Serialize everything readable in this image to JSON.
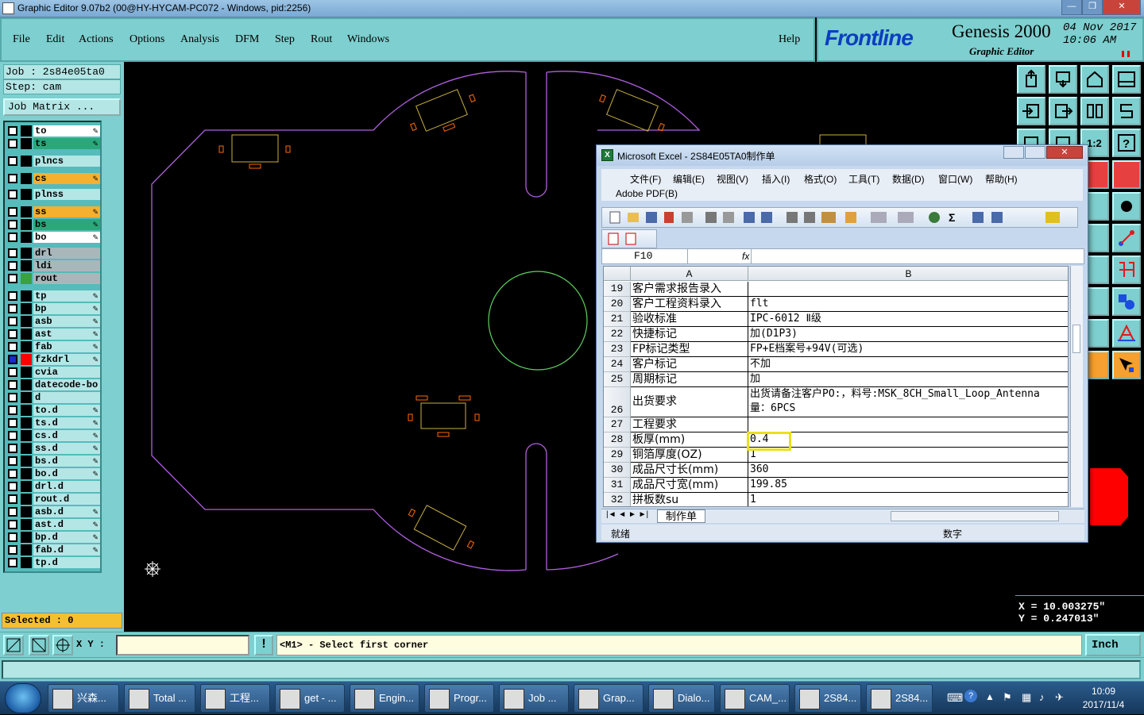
{
  "window": {
    "title": "Graphic Editor 9.07b2 (00@HY-HYCAM-PC072 - Windows, pid:2256)",
    "controls": [
      "—",
      "❐",
      "✕"
    ]
  },
  "menu": {
    "items": [
      "File",
      "Edit",
      "Actions",
      "Options",
      "Analysis",
      "DFM",
      "Step",
      "Rout",
      "Windows"
    ],
    "help": "Help"
  },
  "brand": {
    "logo": "Frontline",
    "product": "Genesis 2000",
    "subtitle": "Graphic Editor",
    "date": "04 Nov 2017",
    "time": "10:06 AM"
  },
  "left": {
    "job": "Job : 2s84e05ta0",
    "step": "Step: cam",
    "job_matrix": "Job Matrix ...",
    "selected": "Selected : 0",
    "layers": [
      {
        "name": "to",
        "color": "#ffffff",
        "swatch": "#000000",
        "editable": true
      },
      {
        "name": "ts",
        "color": "#2aa87a",
        "swatch": "#000000",
        "editable": true
      },
      {
        "name": "plncs",
        "color": "#b4e6e6",
        "swatch": "#000000",
        "editable": false
      },
      {
        "name": "cs",
        "color": "#f5b030",
        "swatch": "#000000",
        "editable": true
      },
      {
        "name": "plnss",
        "color": "#b4e6e6",
        "swatch": "#000000",
        "editable": false
      },
      {
        "name": "ss",
        "color": "#f5b030",
        "swatch": "#000000",
        "editable": true
      },
      {
        "name": "bs",
        "color": "#2aa87a",
        "swatch": "#000000",
        "editable": true
      },
      {
        "name": "bo",
        "color": "#ffffff",
        "swatch": "#000000",
        "editable": true
      },
      {
        "name": "drl",
        "color": "#a9b7bb",
        "swatch": "#000000",
        "editable": false
      },
      {
        "name": "ldi",
        "color": "#a9b7bb",
        "swatch": "#000000",
        "editable": false
      },
      {
        "name": "rout",
        "color": "#a9b7bb",
        "swatch": "#3aa040",
        "editable": false
      },
      {
        "name": "tp",
        "color": "#b4e6e6",
        "swatch": "#000000",
        "editable": true
      },
      {
        "name": "bp",
        "color": "#b4e6e6",
        "swatch": "#000000",
        "editable": true
      },
      {
        "name": "asb",
        "color": "#b4e6e6",
        "swatch": "#000000",
        "editable": true
      },
      {
        "name": "ast",
        "color": "#b4e6e6",
        "swatch": "#000000",
        "editable": true
      },
      {
        "name": "fab",
        "color": "#b4e6e6",
        "swatch": "#000000",
        "editable": true
      },
      {
        "name": "fzkdrl",
        "color": "#b4e6e6",
        "swatch": "#ff0000",
        "editable": true,
        "active": true
      },
      {
        "name": "cvia",
        "color": "#b4e6e6",
        "swatch": "#000000",
        "editable": false
      },
      {
        "name": "datecode-bo",
        "color": "#b4e6e6",
        "swatch": "#000000",
        "editable": false
      },
      {
        "name": "d",
        "color": "#b4e6e6",
        "swatch": "#000000",
        "editable": false
      },
      {
        "name": "to.d",
        "color": "#b4e6e6",
        "swatch": "#000000",
        "editable": true
      },
      {
        "name": "ts.d",
        "color": "#b4e6e6",
        "swatch": "#000000",
        "editable": true
      },
      {
        "name": "cs.d",
        "color": "#b4e6e6",
        "swatch": "#000000",
        "editable": true
      },
      {
        "name": "ss.d",
        "color": "#b4e6e6",
        "swatch": "#000000",
        "editable": true
      },
      {
        "name": "bs.d",
        "color": "#b4e6e6",
        "swatch": "#000000",
        "editable": true
      },
      {
        "name": "bo.d",
        "color": "#b4e6e6",
        "swatch": "#000000",
        "editable": true
      },
      {
        "name": "drl.d",
        "color": "#b4e6e6",
        "swatch": "#000000",
        "editable": false
      },
      {
        "name": "rout.d",
        "color": "#b4e6e6",
        "swatch": "#000000",
        "editable": false
      },
      {
        "name": "asb.d",
        "color": "#b4e6e6",
        "swatch": "#000000",
        "editable": true
      },
      {
        "name": "ast.d",
        "color": "#b4e6e6",
        "swatch": "#000000",
        "editable": true
      },
      {
        "name": "bp.d",
        "color": "#b4e6e6",
        "swatch": "#000000",
        "editable": true
      },
      {
        "name": "fab.d",
        "color": "#b4e6e6",
        "swatch": "#000000",
        "editable": true
      },
      {
        "name": "tp.d",
        "color": "#b4e6e6",
        "swatch": "#000000",
        "editable": false
      }
    ]
  },
  "coords": {
    "x": "X = 10.003275\"",
    "y": "Y = 0.247013\""
  },
  "command": {
    "xy_label": "X Y :",
    "xy_value": "",
    "prompt": "<M1> - Select first corner",
    "unit": "Inch"
  },
  "excel": {
    "title": "Microsoft Excel - 2S84E05TA0制作单",
    "menu": [
      "文件(F)",
      "编辑(E)",
      "视图(V)",
      "插入(I)",
      "格式(O)",
      "工具(T)",
      "数据(D)",
      "窗口(W)",
      "帮助(H)"
    ],
    "pdf_menu": "Adobe PDF(B)",
    "name_box": "F10",
    "fx": "fx",
    "col_a": "A",
    "col_b": "B",
    "rows": [
      {
        "n": "19",
        "a": "客户需求报告录入",
        "b": ""
      },
      {
        "n": "20",
        "a": "客户工程资料录入",
        "b": "flt"
      },
      {
        "n": "21",
        "a": "验收标准",
        "b": "IPC-6012 Ⅱ级"
      },
      {
        "n": "22",
        "a": "快捷标记",
        "b": "加(D1P3)"
      },
      {
        "n": "23",
        "a": "FP标记类型",
        "b": "FP+E档案号+94V(可选)"
      },
      {
        "n": "24",
        "a": "客户标记",
        "b": "不加"
      },
      {
        "n": "25",
        "a": "周期标记",
        "b": "加"
      },
      {
        "n": "26",
        "a": "出货要求",
        "b": "出货请备注客户PO:，料号:MSK_8CH_Small_Loop_Antenna",
        "b2": "量：6PCS"
      },
      {
        "n": "27",
        "a": "工程要求",
        "b": ""
      },
      {
        "n": "28",
        "a": "板厚(mm)",
        "b": "0.4"
      },
      {
        "n": "29",
        "a": "铜箔厚度(OZ)",
        "b": "1"
      },
      {
        "n": "30",
        "a": "成品尺寸长(mm)",
        "b": "360"
      },
      {
        "n": "31",
        "a": "成品尺寸宽(mm)",
        "b": "199.85"
      },
      {
        "n": "32",
        "a": "拼板数su",
        "b": "1"
      }
    ],
    "sheet_tab": "制作单",
    "status_left": "就绪",
    "status_mode": "数字"
  },
  "taskbar": {
    "tasks": [
      "兴森...",
      "Total ...",
      "工程...",
      "get - ...",
      "Engin...",
      "Progr...",
      "Job ...",
      "Grap...",
      "Dialo...",
      "CAM_...",
      "2S84...",
      "2S84..."
    ],
    "time": "10:09",
    "date": "2017/11/4"
  }
}
